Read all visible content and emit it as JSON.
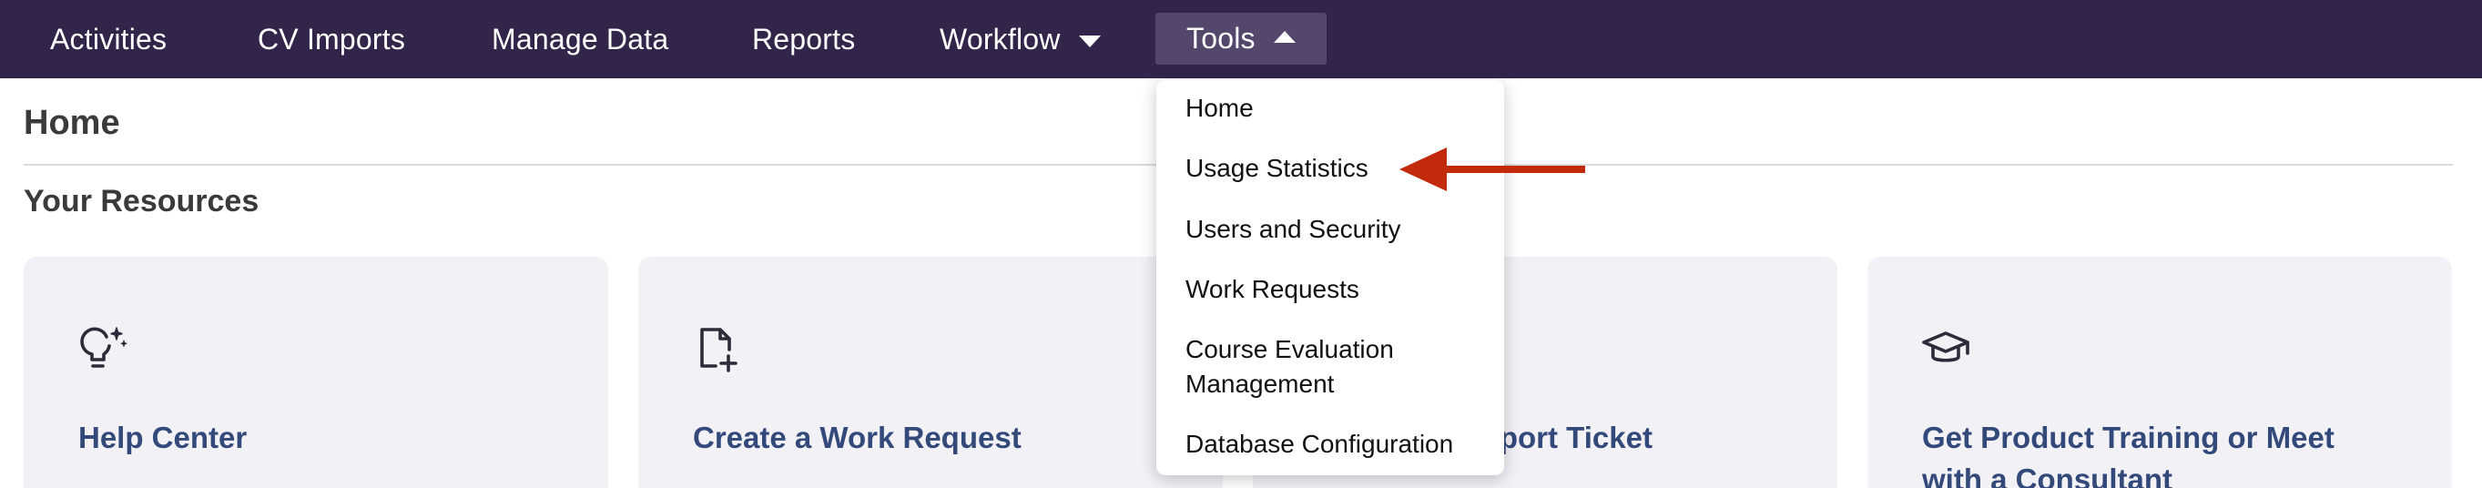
{
  "nav": {
    "items": [
      {
        "label": "Activities"
      },
      {
        "label": "CV Imports"
      },
      {
        "label": "Manage Data"
      },
      {
        "label": "Reports"
      },
      {
        "label": "Workflow"
      },
      {
        "label": "Tools"
      }
    ]
  },
  "page": {
    "title": "Home",
    "section_title": "Your Resources"
  },
  "cards": [
    {
      "title": "Help Center",
      "icon": "lightbulb-sparkle-icon"
    },
    {
      "title": "Create a Work Request",
      "icon": "file-plus-icon"
    },
    {
      "title": "Submit a Support Ticket",
      "icon": "ticket-icon"
    },
    {
      "title": "Get Product Training or Meet with a Consultant",
      "icon": "graduation-cap-icon"
    }
  ],
  "dropdown": {
    "items": [
      {
        "label": "Home"
      },
      {
        "label": "Usage Statistics"
      },
      {
        "label": "Users and Security"
      },
      {
        "label": "Work Requests"
      },
      {
        "label": "Course Evaluation Management"
      },
      {
        "label": "Database Configuration"
      }
    ]
  },
  "colors": {
    "nav_bg": "#33254a",
    "nav_active": "#54476b",
    "card_bg": "#f2f1f6",
    "card_title": "#33497a",
    "arrow": "#c22a0c"
  }
}
